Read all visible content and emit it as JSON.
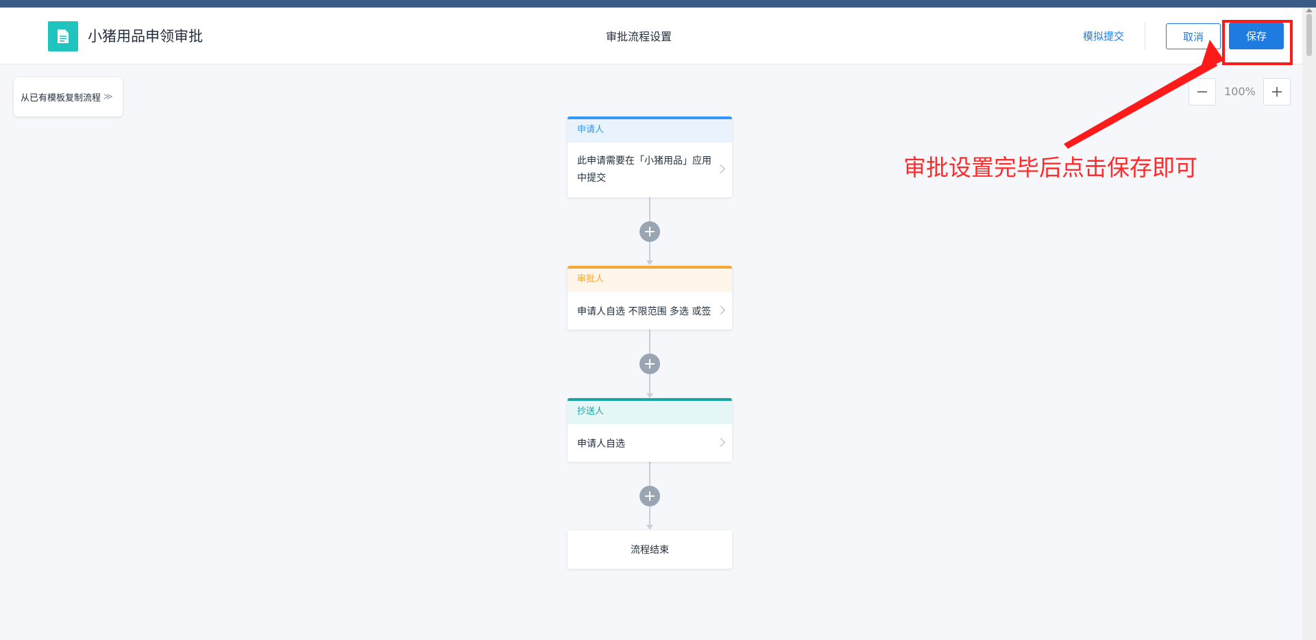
{
  "header": {
    "app_title": "小猪用品申领审批",
    "page_title": "审批流程设置",
    "simulate_submit_label": "模拟提交",
    "cancel_label": "取消",
    "save_label": "保存"
  },
  "toolbar": {
    "copy_template_label": "从已有模板复制流程",
    "copy_template_arrows": "≫",
    "zoom_level": "100%"
  },
  "flow": {
    "applicant": {
      "title": "申请人",
      "content": "此申请需要在「小猪用品」应用中提交"
    },
    "approver": {
      "title": "审批人",
      "content": "申请人自选 不限范围 多选 或签"
    },
    "cc": {
      "title": "抄送人",
      "content": "申请人自选"
    },
    "end": {
      "label": "流程结束"
    }
  },
  "annotation": {
    "text": "审批设置完毕后点击保存即可"
  },
  "colors": {
    "accent": "#1e7be0",
    "applicant": "#3296fa",
    "approver": "#f7a731",
    "cc": "#18a6a0",
    "annotation": "#ff1a1a",
    "app_icon": "#1fc4be"
  },
  "icons": [
    "document-icon",
    "double-chevron-right-icon",
    "minus-icon",
    "plus-icon",
    "add-node-icon",
    "chevron-right-icon",
    "annotation-arrow-icon"
  ]
}
